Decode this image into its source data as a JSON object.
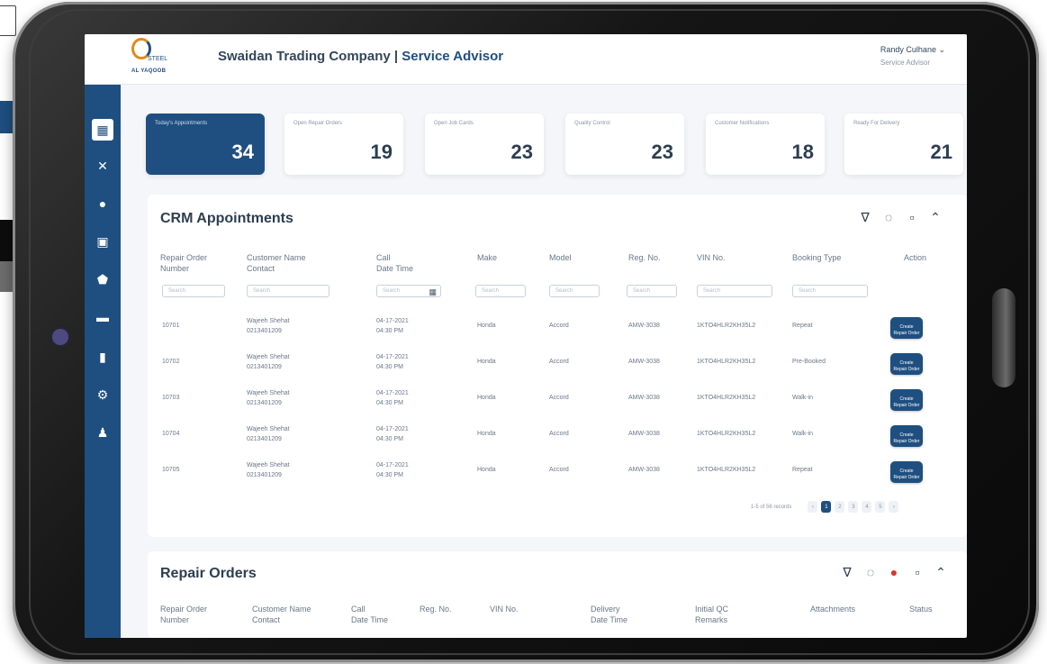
{
  "header": {
    "logo_text1": "STEEL",
    "logo_text2": "AL YAQOOB",
    "company": "Swaidan Trading Company",
    "separator": " | ",
    "role_title": "Service Advisor",
    "user_name": "Randy Culhane ⌄",
    "user_role": "Service Advisor"
  },
  "sidebar": {
    "items": [
      {
        "icon": "dashboard-icon",
        "glyph": "▦"
      },
      {
        "icon": "tools-icon",
        "glyph": "✕"
      },
      {
        "icon": "gear-icon",
        "glyph": "●"
      },
      {
        "icon": "id-card-icon",
        "glyph": "▣"
      },
      {
        "icon": "shield-icon",
        "glyph": "⬟"
      },
      {
        "icon": "car-icon",
        "glyph": "▬"
      },
      {
        "icon": "document-icon",
        "glyph": "▮"
      },
      {
        "icon": "settings-icon",
        "glyph": "⚙"
      },
      {
        "icon": "users-icon",
        "glyph": "♟"
      }
    ]
  },
  "kpis": [
    {
      "label": "Today's Appointments",
      "value": "34"
    },
    {
      "label": "Open Repair Orders",
      "value": "19"
    },
    {
      "label": "Open Job Cards",
      "value": "23"
    },
    {
      "label": "Quality Control",
      "value": "23"
    },
    {
      "label": "Customer Notifications",
      "value": "18"
    },
    {
      "label": "Ready For Delivery",
      "value": "21"
    }
  ],
  "crm": {
    "title": "CRM Appointments",
    "columns": [
      "Repair Order\nNumber",
      "Customer Name\nContact",
      "Call\nDate Time",
      "Make",
      "Model",
      "Reg. No.",
      "VIN No.",
      "Booking Type",
      "Action"
    ],
    "search_placeholder": "Search",
    "rows": [
      {
        "ro": "10701",
        "name": "Wajeeh Shehat",
        "contact": "0213401209",
        "date": "04-17-2021",
        "time": "04:30 PM",
        "make": "Honda",
        "model": "Accord",
        "reg": "AMW-3038",
        "vin": "1KTO4HLR2KH35L2",
        "booking": "Repeat"
      },
      {
        "ro": "10702",
        "name": "Wajeeh Shehat",
        "contact": "0213401209",
        "date": "04-17-2021",
        "time": "04:30 PM",
        "make": "Honda",
        "model": "Accord",
        "reg": "AMW-3038",
        "vin": "1KTO4HLR2KH35L2",
        "booking": "Pre-Booked"
      },
      {
        "ro": "10703",
        "name": "Wajeeh Shehat",
        "contact": "0213401209",
        "date": "04-17-2021",
        "time": "04:30 PM",
        "make": "Honda",
        "model": "Accord",
        "reg": "AMW-3038",
        "vin": "1KTO4HLR2KH35L2",
        "booking": "Walk-in"
      },
      {
        "ro": "10704",
        "name": "Wajeeh Shehat",
        "contact": "0213401209",
        "date": "04-17-2021",
        "time": "04:30 PM",
        "make": "Honda",
        "model": "Accord",
        "reg": "AMW-3038",
        "vin": "1KTO4HLR2KH35L2",
        "booking": "Walk-in"
      },
      {
        "ro": "10705",
        "name": "Wajeeh Shehat",
        "contact": "0213401209",
        "date": "04-17-2021",
        "time": "04:30 PM",
        "make": "Honda",
        "model": "Accord",
        "reg": "AMW-3038",
        "vin": "1KTO4HLR2KH35L2",
        "booking": "Repeat"
      }
    ],
    "action_label": "Create\nRepair Order",
    "records_text": "1-5 of 56 records",
    "pages": [
      "‹",
      "1",
      "2",
      "3",
      "4",
      "5",
      "›"
    ]
  },
  "repair_orders": {
    "title": "Repair Orders",
    "columns": [
      "Repair Order\nNumber",
      "Customer Name\nContact",
      "Call\nDate Time",
      "Reg. No.",
      "VIN No.",
      "Delivery\nDate Time",
      "Initial QC\nRemarks",
      "Attachments",
      "Status"
    ]
  },
  "colors": {
    "brand": "#1f4f80",
    "accent": "#e08a1e",
    "alert": "#d9342b"
  }
}
